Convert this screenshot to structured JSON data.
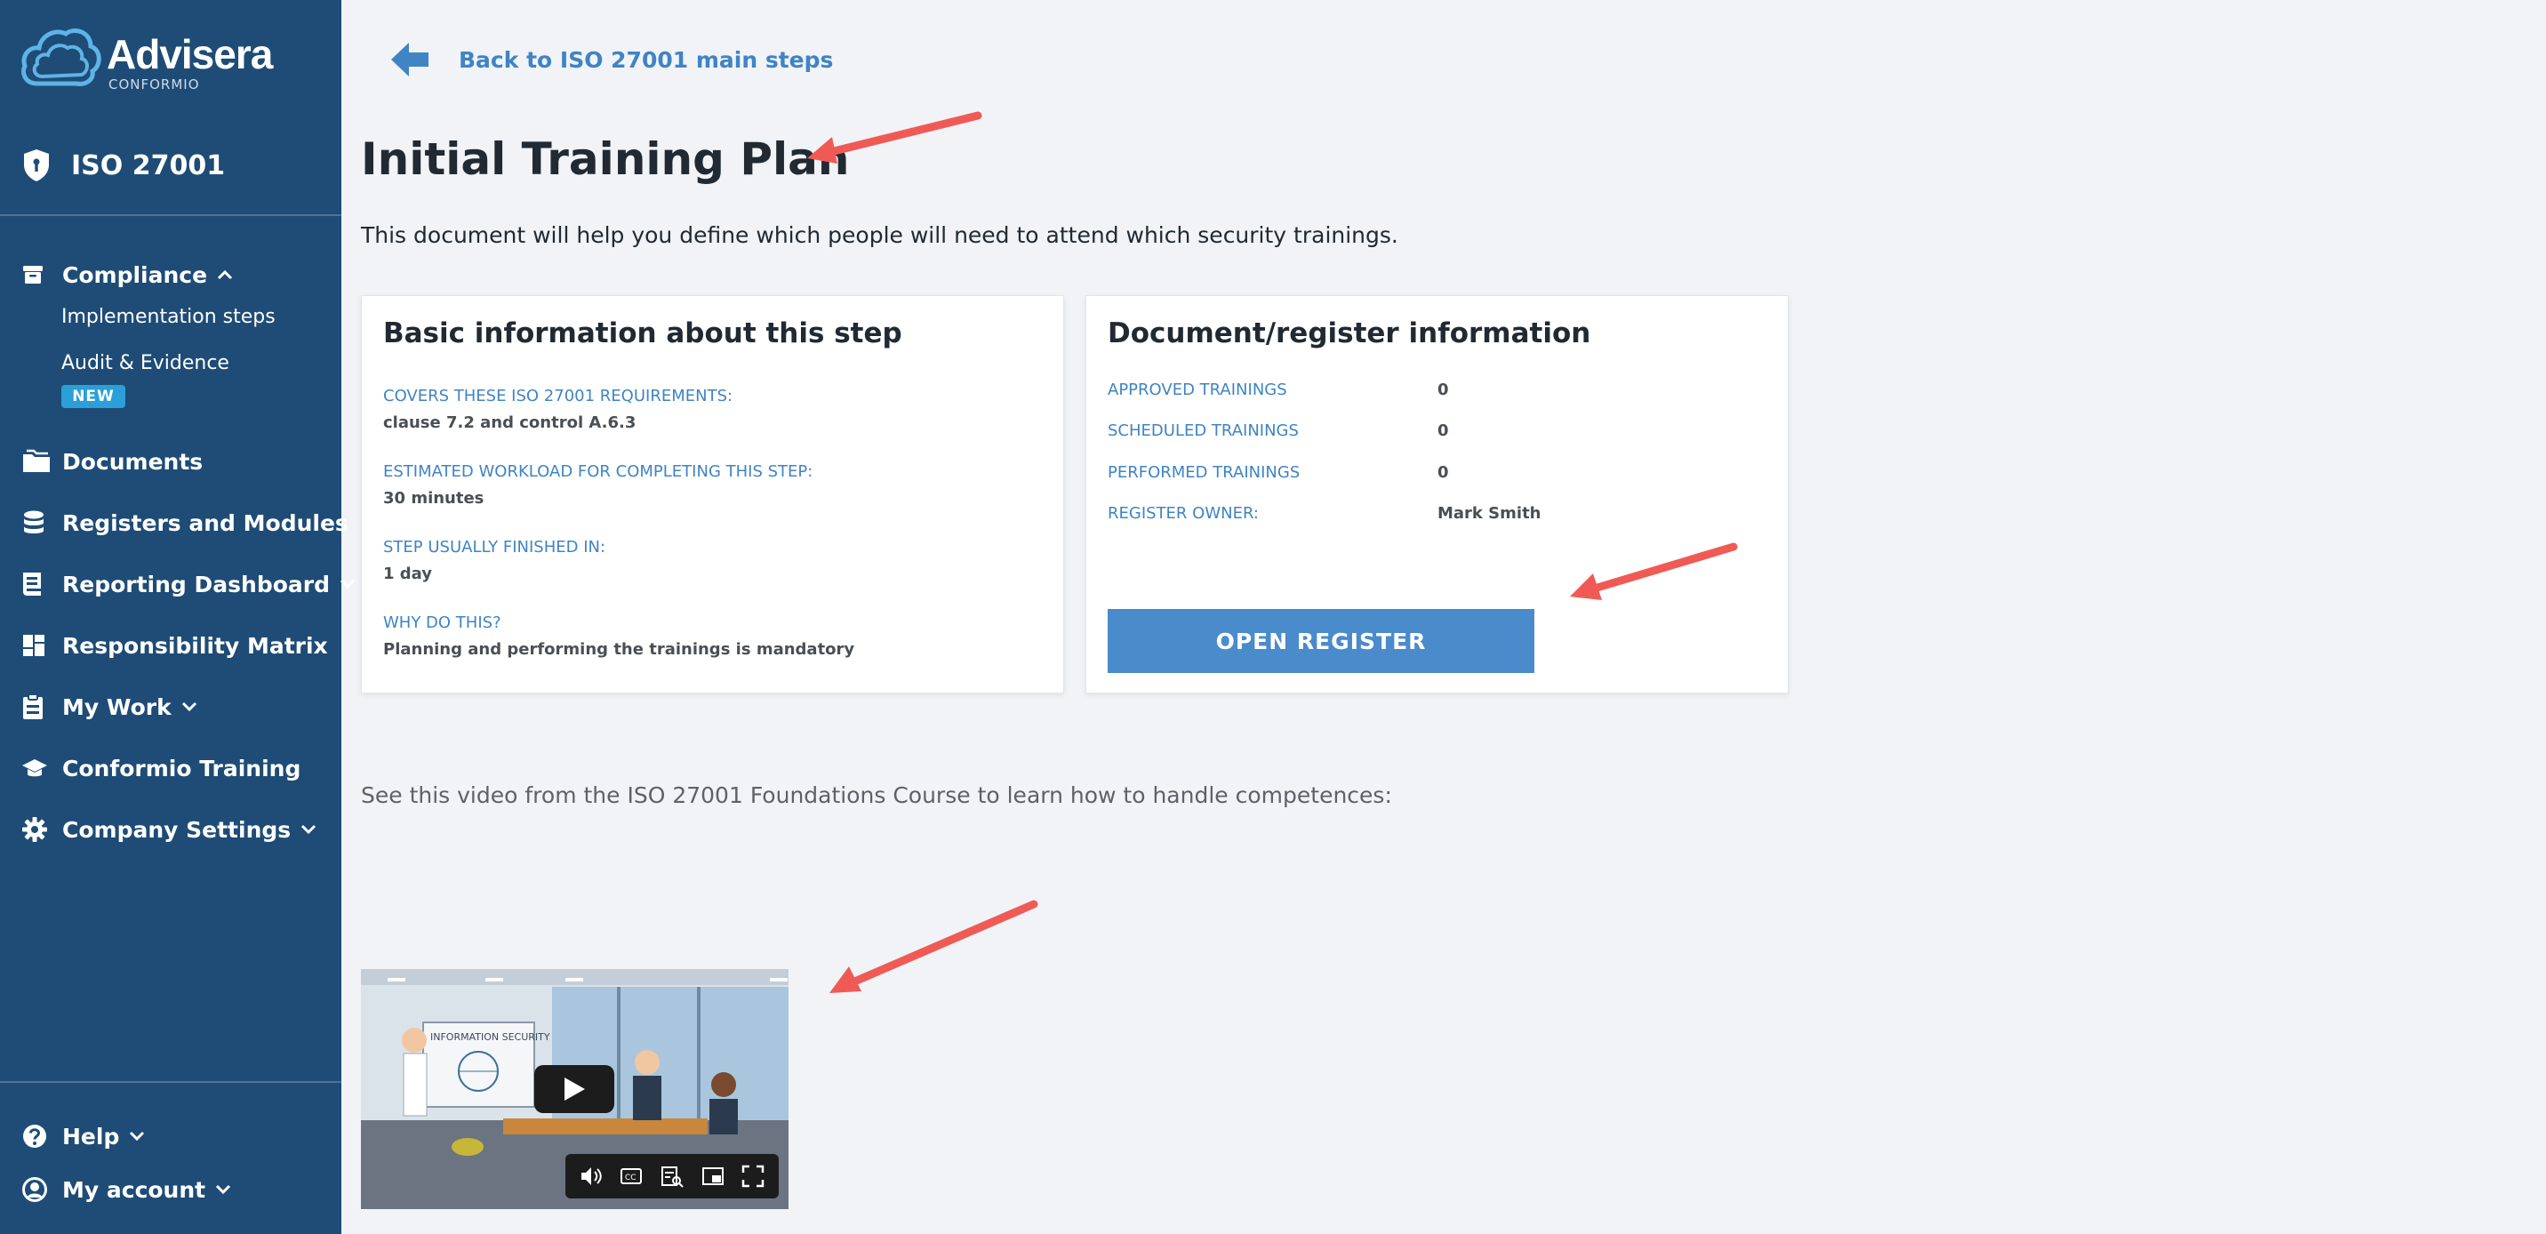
{
  "sidebar": {
    "logo_text": "Advisera",
    "logo_subtext": "CONFORMIO",
    "product": "ISO 27001",
    "compliance": {
      "label": "Compliance",
      "sub_items": [
        "Implementation steps",
        "Audit & Evidence"
      ],
      "badge": "NEW"
    },
    "items": [
      {
        "label": "Documents",
        "icon": "folder-icon"
      },
      {
        "label": "Registers and Modules",
        "icon": "database-icon"
      },
      {
        "label": "Reporting Dashboard",
        "icon": "report-icon"
      },
      {
        "label": "Responsibility Matrix",
        "icon": "grid-icon"
      },
      {
        "label": "My Work",
        "icon": "clipboard-icon"
      },
      {
        "label": "Conformio Training",
        "icon": "graduation-cap-icon"
      },
      {
        "label": "Company Settings",
        "icon": "gear-icon"
      }
    ],
    "bottom": [
      {
        "label": "Help",
        "icon": "help-icon"
      },
      {
        "label": "My account",
        "icon": "account-icon"
      }
    ]
  },
  "main": {
    "back_link": "Back to ISO 27001 main steps",
    "title": "Initial Training Plan",
    "description": "This document will help you define which people will need to attend which security trainings.",
    "basic_card": {
      "title": "Basic information about this step",
      "fields": [
        {
          "label": "COVERS THESE ISO 27001 REQUIREMENTS:",
          "value": "clause 7.2 and control A.6.3"
        },
        {
          "label": "ESTIMATED WORKLOAD FOR COMPLETING THIS STEP:",
          "value": "30 minutes"
        },
        {
          "label": "STEP USUALLY FINISHED IN:",
          "value": "1 day"
        },
        {
          "label": "WHY DO THIS?",
          "value": "Planning and performing the trainings is mandatory"
        }
      ]
    },
    "register_card": {
      "title": "Document/register information",
      "fields": [
        {
          "label": "APPROVED TRAININGS",
          "value": "0"
        },
        {
          "label": "SCHEDULED TRAININGS",
          "value": "0"
        },
        {
          "label": "PERFORMED TRAININGS",
          "value": "0"
        },
        {
          "label": "REGISTER OWNER:",
          "value": "Mark Smith"
        }
      ],
      "button": "OPEN REGISTER"
    },
    "video_intro": "See this video from the ISO 27001 Foundations Course to learn how to handle competences:",
    "video_board_text": "INFORMATION SECURITY"
  },
  "colors": {
    "sidebar_bg": "#1e4c76",
    "accent": "#3f84c4",
    "button": "#4a8bcb",
    "badge": "#2a9fd8",
    "annotation_arrow": "#f05a55"
  }
}
